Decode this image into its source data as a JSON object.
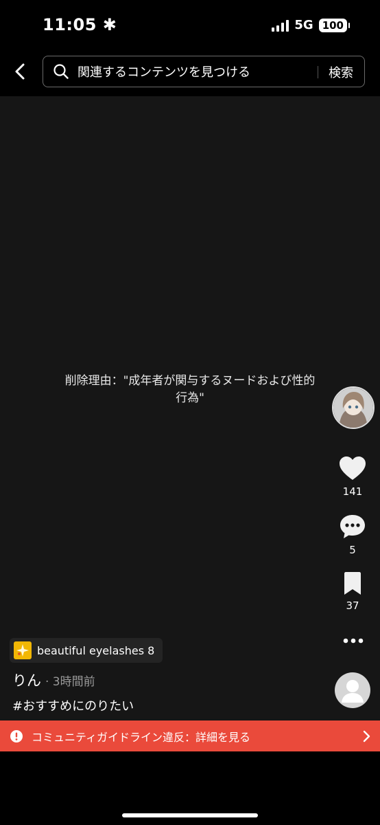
{
  "status_bar": {
    "time": "11:05",
    "time_icon": "asterisk-icon",
    "network": "5G",
    "battery": "100"
  },
  "search": {
    "placeholder": "関連するコンテンツを見つける",
    "submit_label": "検索"
  },
  "video": {
    "removal_reason": "削除理由：\"成年者が関与するヌードおよび性的行為\""
  },
  "actions": {
    "likes": "141",
    "comments": "5",
    "bookmarks": "37"
  },
  "sound": {
    "label": "beautiful eyelashes 8",
    "icon": "sparkle-badge-icon",
    "icon_color": "#f2b705"
  },
  "author": {
    "name": "りん",
    "time": "· 3時間前"
  },
  "caption": "#おすすめにのりたい",
  "violation": {
    "text": "コミュニティガイドライン違反：詳細を見る",
    "color": "#ea4a3b"
  }
}
